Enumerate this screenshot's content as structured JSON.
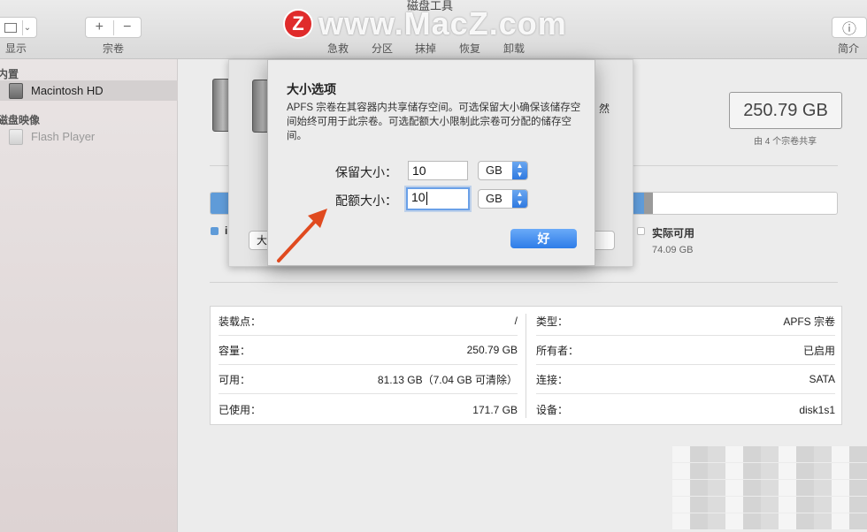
{
  "window": {
    "title": "磁盘工具"
  },
  "toolbar": {
    "view_label": "显示",
    "add_icon": "+",
    "remove_icon": "−",
    "volume_label": "宗卷",
    "actions": [
      "急救",
      "分区",
      "抹掉",
      "恢复",
      "卸载"
    ],
    "info_icon": "ⓘ",
    "info_label": "简介"
  },
  "watermark": {
    "logo": "Z",
    "text": "www.MacZ.com"
  },
  "sidebar": {
    "section_internal": "内置",
    "internal_items": [
      "Macintosh HD"
    ],
    "section_images": "磁盘映像",
    "image_items": [
      "Flash Player"
    ]
  },
  "summary": {
    "capacity": "250.79 GB",
    "capacity_note": "由 4 个宗卷共享",
    "legend": [
      {
        "label": "实际可用",
        "value": "74.09 GB",
        "color": "#ffffff"
      }
    ],
    "legend_used_partial": "i",
    "used_color": "#5f9bd8"
  },
  "usage": {
    "used_fraction": 0.69,
    "purgeable_fraction": 0.014
  },
  "back_sheet": {
    "left_button_partial": "大",
    "text_partial": "然"
  },
  "dialog": {
    "title": "大小选项",
    "description": "APFS 宗卷在其容器内共享储存空间。可选保留大小确保该储存空间始终可用于此宗卷。可选配额大小限制此宗卷可分配的储存空间。",
    "reserve_label": "保留大小：",
    "reserve_value": "10",
    "reserve_unit": "GB",
    "quota_label": "配额大小：",
    "quota_value": "10",
    "quota_unit": "GB",
    "ok_label": "好"
  },
  "info": {
    "left": [
      {
        "label": "装载点：",
        "value": "/"
      },
      {
        "label": "容量：",
        "value": "250.79 GB"
      },
      {
        "label": "可用：",
        "value": "81.13 GB（7.04 GB 可清除）"
      },
      {
        "label": "已使用：",
        "value": "171.7 GB"
      }
    ],
    "right": [
      {
        "label": "类型：",
        "value": "APFS 宗卷"
      },
      {
        "label": "所有者：",
        "value": "已启用"
      },
      {
        "label": "连接：",
        "value": "SATA"
      },
      {
        "label": "设备：",
        "value": "disk1s1"
      }
    ]
  }
}
